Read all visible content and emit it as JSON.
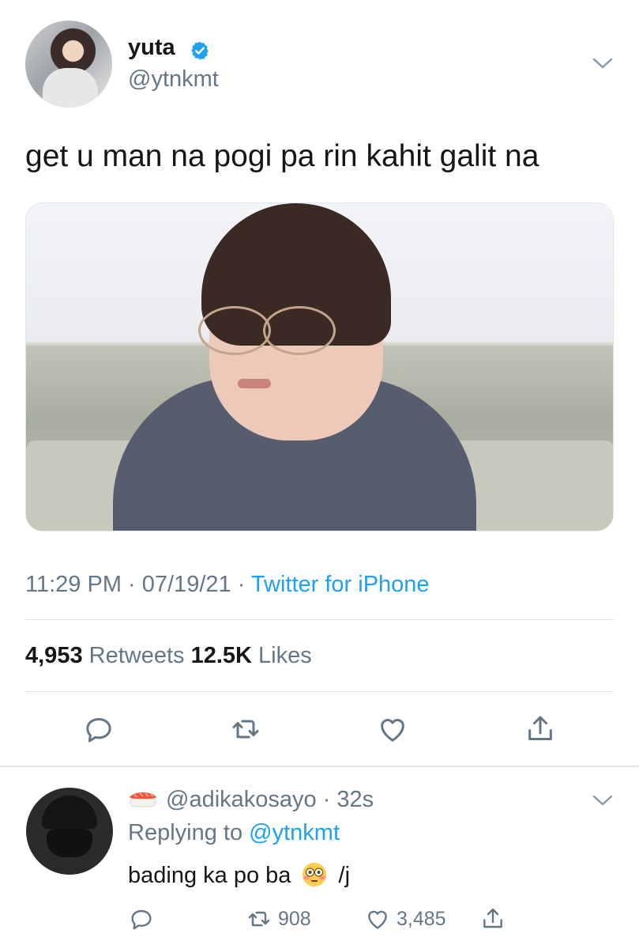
{
  "tweet": {
    "name": "yuta",
    "handle": "@ytnkmt",
    "text": "get u man na pogi pa rin kahit galit na",
    "time": "11:29 PM · 07/19/21 ·",
    "source": "Twitter for iPhone",
    "retweets_count": "4,953",
    "retweets_label": "Retweets",
    "likes_count": "12.5K",
    "likes_label": "Likes",
    "verified_color": "#1da1f2"
  },
  "reply": {
    "handle_time": "@adikakosayo · 32s",
    "replying_label": "Replying to",
    "replying_to": "@ytnkmt",
    "text_before": "bading ka po ba",
    "text_after": "/j",
    "retweets": "908",
    "likes": "3,485"
  },
  "icons": [
    "verified-badge-icon",
    "chevron-down-icon",
    "reply-icon",
    "retweet-icon",
    "like-icon",
    "share-icon",
    "sushi-emoji-icon",
    "flushed-face-emoji-icon"
  ]
}
